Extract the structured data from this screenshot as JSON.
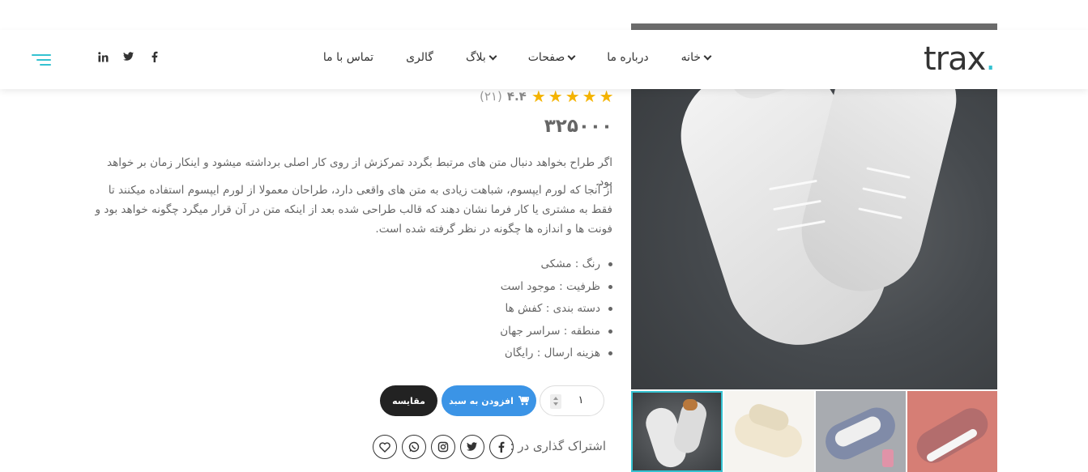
{
  "header": {
    "logo": "trax",
    "nav": [
      {
        "label": "خانه",
        "dropdown": true
      },
      {
        "label": "درباره ما",
        "dropdown": false
      },
      {
        "label": "صفحات",
        "dropdown": true
      },
      {
        "label": "بلاگ",
        "dropdown": true
      },
      {
        "label": "گالری",
        "dropdown": false
      },
      {
        "label": "تماس با ما",
        "dropdown": false
      }
    ],
    "social": [
      "facebook-icon",
      "twitter-icon",
      "linkedin-icon"
    ],
    "accent_color": "#35c2d1"
  },
  "product": {
    "rating_value": "۴.۴",
    "rating_count": "(۲۱)",
    "stars": 4.4,
    "price": "۳۲۵۰۰۰",
    "description_1": "اگر طراح بخواهد دنبال متن های مرتبط بگردد تمرکزش از روی کار اصلی برداشته میشود و اینکار زمان بر خواهد بود.",
    "description_2": "از آنجا که لورم ایپسوم، شباهت زیادی به متن های واقعی دارد، طراحان معمولا از لورم ایپسوم استفاده میکنند تا فقط به مشتری یا کار فرما نشان دهند که قالب طراحی شده بعد از اینکه متن در آن قرار میگرد چگونه خواهد بود و فونت ها و اندازه ها چگونه در نظر گرفته شده است.",
    "specs": [
      "رنگ : مشکی",
      "ظرفیت : موجود است",
      "دسته بندی : کفش ها",
      "منطقه : سراسر جهان",
      "هزینه ارسال : رایگان"
    ],
    "quantity": "۱",
    "add_to_cart": "افزودن به سبد",
    "compare": "مقایسه",
    "share_label": "اشتراک گذاری در :"
  },
  "colors": {
    "cart_button": "#3b94e6",
    "compare_button": "#222222",
    "star": "#f5b400"
  }
}
